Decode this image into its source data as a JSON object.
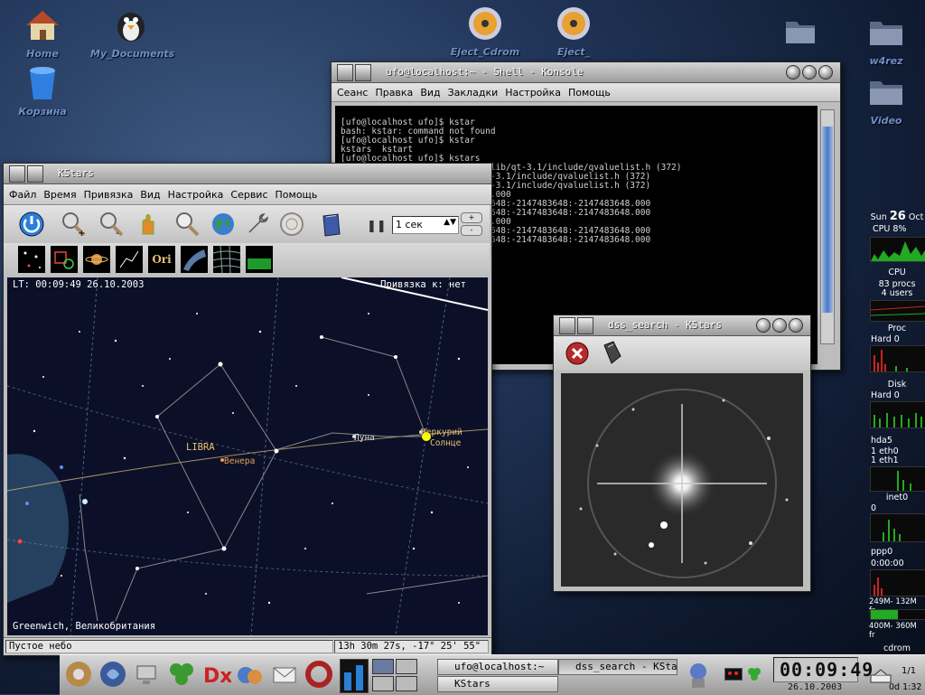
{
  "desktop": {
    "icons": [
      {
        "label": "Home"
      },
      {
        "label": "My_Documents"
      },
      {
        "label": "Корзина"
      },
      {
        "label": "Eject_Cdrom"
      },
      {
        "label": "Eject_"
      },
      {
        "label": "w4rez"
      },
      {
        "label": "Video"
      }
    ]
  },
  "konsole": {
    "title": "ufo@localhost:~ - Shell - Konsole",
    "menu": [
      "Сеанс",
      "Правка",
      "Вид",
      "Закладки",
      "Настройка",
      "Помощь"
    ],
    "lines": [
      "[ufo@localhost ufo]$ kstar",
      "bash: kstar: command not found",
      "[ufo@localhost ufo]$ kstar",
      "kstars  kstart",
      "[ufo@localhost ufo]$ kstars",
      "ASSERT: \"i <= nodes\" in /usr/lib/qt-3.1/include/qvaluelist.h (372)",
      "                      /lib/qt-3.1/include/qvaluelist.h (372)",
      "                      /lib/qt-3.1/include/qvaluelist.h (372)",
      "                      5:00:00.000",
      "                      2147483648:-2147483648:-2147483648.000",
      "                      2147483648:-2147483648:-2147483648.000",
      "                      5:00:00.000",
      "                      2147483648:-2147483648:-2147483648.000",
      "                      2147483648:-2147483648:-2147483648.000"
    ]
  },
  "kstars": {
    "title": "KStars",
    "menu": [
      "Файл",
      "Время",
      "Привязка",
      "Вид",
      "Настройка",
      "Сервис",
      "Помощь"
    ],
    "time_step": "1 сек",
    "toolbar2_ori": "Ori",
    "sky": {
      "lt": "LT: 00:09:49   26.10.2003",
      "focus": "Привязка к: нет",
      "constellation": "LIBRA",
      "labels": {
        "moon": "Луна",
        "mercury": "Меркурий",
        "sun": "Солнце",
        "venus": "Венера"
      },
      "location": "Greenwich, Великобритания"
    },
    "status_left": "Пустое небо",
    "status_right": "13h 30m 27s,  -17° 25' 55\""
  },
  "dss": {
    "title": "dss_search - KStars"
  },
  "sysmon": {
    "day": "Sun",
    "date": "26",
    "month": "Oct",
    "cpu_pct": "CPU 8%",
    "cpu_label": "CPU",
    "procs": "83 procs",
    "users": "4 users",
    "proc_label": "Proc",
    "hard0_a": "Hard 0",
    "disk_label": "Disk",
    "hard0_b": "Hard 0",
    "hda5": "hda5",
    "eth0": "1 eth0",
    "eth1": "1 eth1",
    "inet0": "inet0",
    "zero": "0",
    "ppp0": "ppp0",
    "ppp_time": "0:00:00",
    "mem1": "249M- 132M fr",
    "mem2": "400M- 360M fr",
    "cdrom": "cdrom",
    "cd_count": "1/1",
    "clock_small": "0d 1:32"
  },
  "taskbar": {
    "tasks": [
      "ufo@localhost:~",
      "dss_search - KStars",
      "KStars"
    ],
    "clock": "00:09:49",
    "date": "26.10.2003"
  }
}
